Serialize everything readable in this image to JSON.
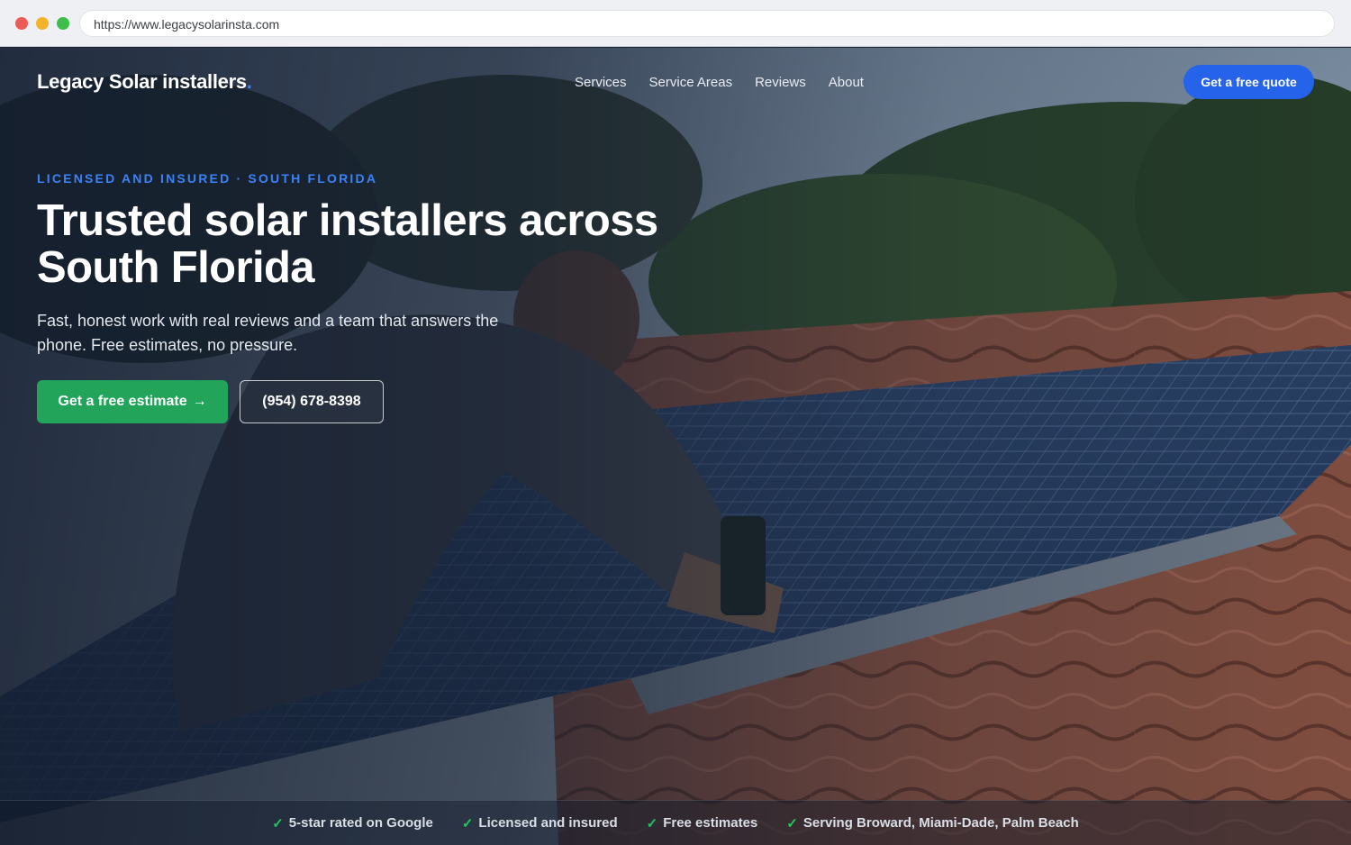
{
  "browser": {
    "url": "https://www.legacysolarinsta.com"
  },
  "header": {
    "logo_text": "Legacy Solar installers",
    "logo_dot": ".",
    "nav": [
      {
        "label": "Services"
      },
      {
        "label": "Service Areas"
      },
      {
        "label": "Reviews"
      },
      {
        "label": "About"
      }
    ],
    "cta_label": "Get a free quote"
  },
  "hero": {
    "eyebrow": "LICENSED AND INSURED · SOUTH FLORIDA",
    "headline": "Trusted solar installers across South Florida",
    "subtext": "Fast, honest work with real reviews and a team that answers the phone. Free estimates, no pressure.",
    "primary_button": "Get a free estimate",
    "primary_button_arrow": "→",
    "phone_button": "(954) 678-8398"
  },
  "trust": {
    "check_glyph": "✓",
    "items": [
      {
        "label": "5-star rated on Google"
      },
      {
        "label": "Licensed and insured"
      },
      {
        "label": "Free estimates"
      },
      {
        "label": "Serving Broward, Miami-Dade, Palm Beach"
      }
    ]
  },
  "colors": {
    "accent_blue": "#2563eb",
    "eyebrow_blue": "#3b82f6",
    "cta_green": "#22a55a",
    "check_green": "#22c55e"
  }
}
